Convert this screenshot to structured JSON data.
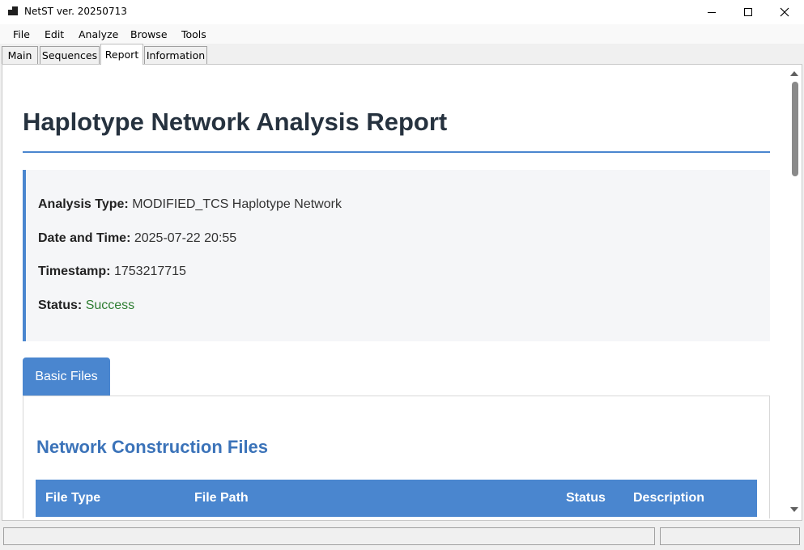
{
  "window": {
    "title": "NetST ver. 20250713"
  },
  "menu": [
    "File",
    "Edit",
    "Analyze",
    "Browse",
    "Tools"
  ],
  "tabs": [
    {
      "label": "Main",
      "active": false
    },
    {
      "label": "Sequences",
      "active": false
    },
    {
      "label": "Report",
      "active": true
    },
    {
      "label": "Information",
      "active": false
    }
  ],
  "report": {
    "title": "Haplotype Network Analysis Report",
    "info": {
      "analysis_type_label": "Analysis Type:",
      "analysis_type_value": "MODIFIED_TCS Haplotype Network",
      "datetime_label": "Date and Time:",
      "datetime_value": "2025-07-22 20:55",
      "timestamp_label": "Timestamp:",
      "timestamp_value": "1753217715",
      "status_label": "Status:",
      "status_value": "Success"
    },
    "active_tab": "Basic Files",
    "section_heading": "Network Construction Files",
    "table_headers": [
      "File Type",
      "File Path",
      "Status",
      "Description"
    ]
  },
  "colors": {
    "accent": "#4a86cf",
    "heading": "#3b73b9",
    "success": "#2e7d32",
    "title_text": "#26323f"
  },
  "icons": {
    "app": "app-icon",
    "minimize": "minimize-icon",
    "maximize": "maximize-icon",
    "close": "close-icon"
  }
}
